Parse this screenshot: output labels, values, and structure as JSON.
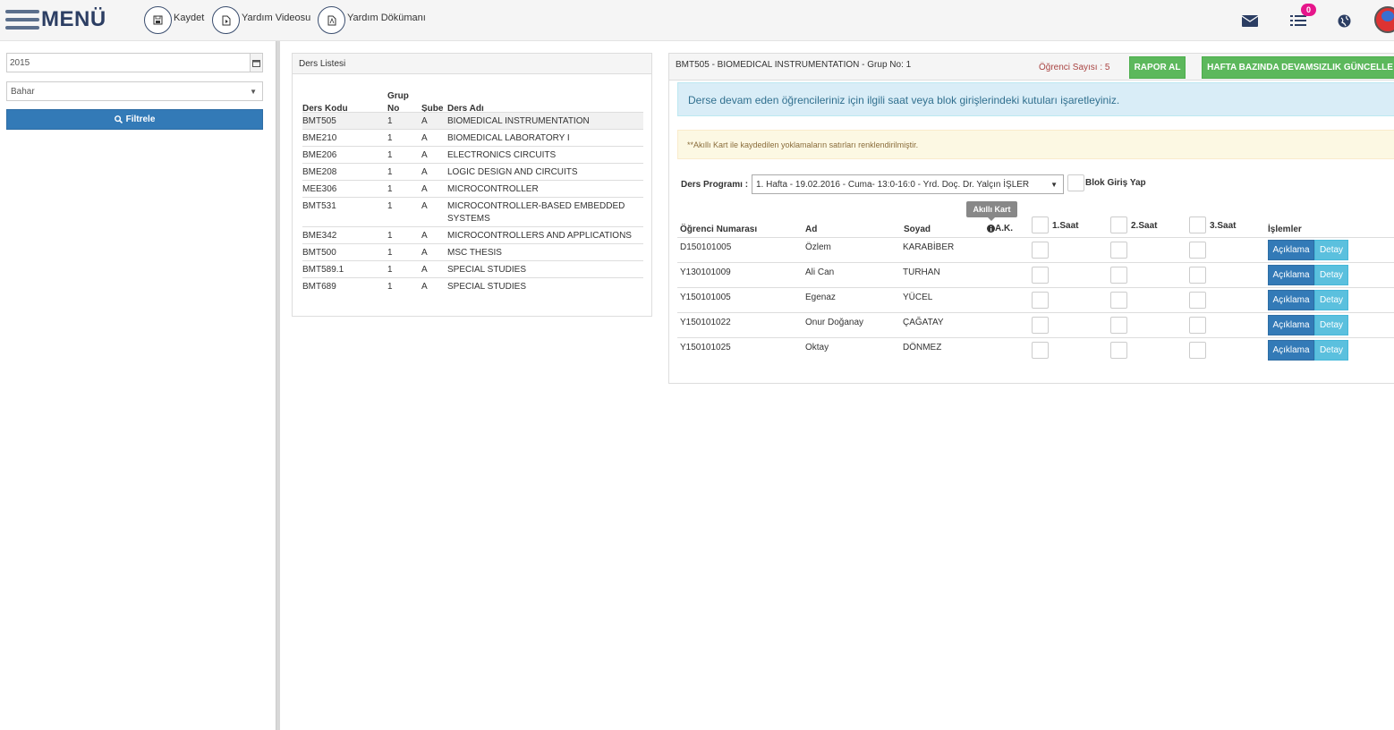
{
  "topbar": {
    "menu_label": "MENÜ",
    "actions": [
      {
        "label": "Kaydet",
        "icon": "save-icon"
      },
      {
        "label": "Yardım Videosu",
        "icon": "video-file-icon"
      },
      {
        "label": "Yardım Dökümanı",
        "icon": "pdf-file-icon"
      }
    ],
    "notification_count": "0",
    "accent_badge_color": "#e6168b"
  },
  "filters": {
    "year_value": "2015",
    "term_value": "Bahar",
    "filter_button": "Filtrele"
  },
  "course_list": {
    "title": "Ders Listesi",
    "headers": {
      "code": "Ders Kodu",
      "group_line1": "Grup",
      "group_line2": "No",
      "section": "Şube",
      "name": "Ders Adı"
    },
    "rows": [
      {
        "code": "BMT505",
        "group": "1",
        "section": "A",
        "name": "BIOMEDICAL INSTRUMENTATION"
      },
      {
        "code": "BME210",
        "group": "1",
        "section": "A",
        "name": "BIOMEDICAL LABORATORY I"
      },
      {
        "code": "BME206",
        "group": "1",
        "section": "A",
        "name": "ELECTRONICS CIRCUITS"
      },
      {
        "code": "BME208",
        "group": "1",
        "section": "A",
        "name": "LOGIC DESIGN AND CIRCUITS"
      },
      {
        "code": "MEE306",
        "group": "1",
        "section": "A",
        "name": "MICROCONTROLLER"
      },
      {
        "code": "BMT531",
        "group": "1",
        "section": "A",
        "name": "MICROCONTROLLER-BASED EMBEDDED",
        "name2": "SYSTEMS"
      },
      {
        "code": "BME342",
        "group": "1",
        "section": "A",
        "name": "MICROCONTROLLERS AND APPLICATIONS"
      },
      {
        "code": "BMT500",
        "group": "1",
        "section": "A",
        "name": "MSC THESIS"
      },
      {
        "code": "BMT589.1",
        "group": "1",
        "section": "A",
        "name": "SPECIAL STUDIES"
      },
      {
        "code": "BMT689",
        "group": "1",
        "section": "A",
        "name": "SPECIAL STUDIES"
      }
    ]
  },
  "attendance": {
    "title": "BMT505 - BIOMEDICAL INSTRUMENTATION - Grup No: 1",
    "student_count": "Öğrenci Sayısı : 5",
    "report_button": "RAPOR AL",
    "weekly_button": "HAFTA BAZINDA DEVAMSIZLIK GÜNCELLE",
    "info_text": "Derse devam eden öğrencileriniz için ilgili saat veya blok girişlerindeki kutuları işaretleyiniz.",
    "warning_text": "**Akıllı Kart ile kaydedilen yoklamaların satırları renklendirilmiştir.",
    "program_label": "Ders Programı :",
    "program_value": "1. Hafta - 19.02.2016 - Cuma- 13:0-16:0 - Yrd. Doç. Dr. Yalçın İŞLER",
    "block_label": "Blok Giriş Yap",
    "tooltip": "Akıllı Kart",
    "headers": {
      "number": "Öğrenci Numarası",
      "first": "Ad",
      "last": "Soyad",
      "ak": "A.K.",
      "h1": "1.Saat",
      "h2": "2.Saat",
      "h3": "3.Saat",
      "ops": "İşlemler"
    },
    "note_button": "Açıklama",
    "detail_button": "Detay",
    "students": [
      {
        "number": "D150101005",
        "first": "Özlem",
        "last": "KARABİBER"
      },
      {
        "number": "Y130101009",
        "first": "Ali Can",
        "last": "TURHAN"
      },
      {
        "number": "Y150101005",
        "first": "Egenaz",
        "last": "YÜCEL"
      },
      {
        "number": "Y150101022",
        "first": "Onur Doğanay",
        "last": "ÇAĞATAY"
      },
      {
        "number": "Y150101025",
        "first": "Oktay",
        "last": "DÖNMEZ"
      }
    ]
  }
}
